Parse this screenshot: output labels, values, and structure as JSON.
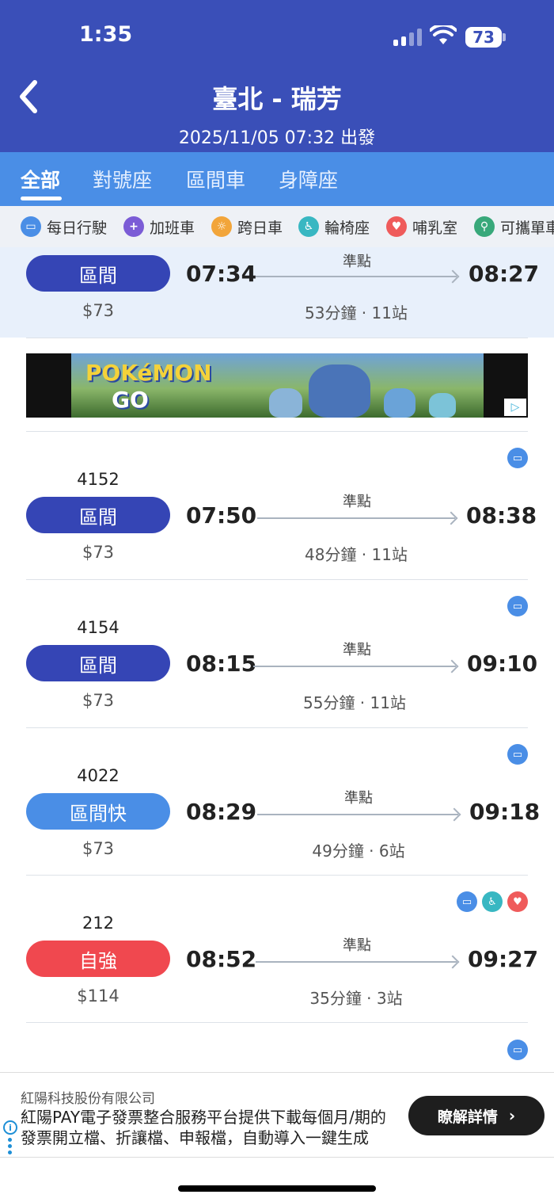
{
  "status_bar": {
    "time": "1:35",
    "battery": "73"
  },
  "header": {
    "title": "臺北 - 瑞芳",
    "subtitle": "2025/11/05 07:32 出發"
  },
  "tabs": [
    {
      "label": "全部",
      "active": true
    },
    {
      "label": "對號座",
      "active": false
    },
    {
      "label": "區間車",
      "active": false
    },
    {
      "label": "身障座",
      "active": false
    }
  ],
  "filters": [
    {
      "label": "每日行駛",
      "icon": "train-icon",
      "color": "#4a8ee6"
    },
    {
      "label": "加班車",
      "icon": "extra-train-icon",
      "color": "#7b5cd6"
    },
    {
      "label": "跨日車",
      "icon": "overnight-icon",
      "color": "#f2a53a"
    },
    {
      "label": "輪椅座",
      "icon": "wheelchair-icon",
      "color": "#38b7c2"
    },
    {
      "label": "哺乳室",
      "icon": "nursing-room-icon",
      "color": "#ef5b5b"
    },
    {
      "label": "可攜單車",
      "icon": "bicycle-icon",
      "color": "#38a87a"
    }
  ],
  "trains": [
    {
      "number": "",
      "type": "區間",
      "type_color": "#3545b5",
      "depart": "07:34",
      "arrive": "08:27",
      "status": "準點",
      "price": "$73",
      "duration": "53分鐘 · 11站"
    },
    {
      "number": "4152",
      "type": "區間",
      "type_color": "#3545b5",
      "depart": "07:50",
      "arrive": "08:38",
      "status": "準點",
      "price": "$73",
      "duration": "48分鐘 · 11站"
    },
    {
      "number": "4154",
      "type": "區間",
      "type_color": "#3545b5",
      "depart": "08:15",
      "arrive": "09:10",
      "status": "準點",
      "price": "$73",
      "duration": "55分鐘 · 11站"
    },
    {
      "number": "4022",
      "type": "區間快",
      "type_color": "#4a8ee6",
      "depart": "08:29",
      "arrive": "09:18",
      "status": "準點",
      "price": "$73",
      "duration": "49分鐘 · 6站"
    },
    {
      "number": "212",
      "type": "自強",
      "type_color": "#f0484f",
      "depart": "08:52",
      "arrive": "09:27",
      "status": "準點",
      "price": "$114",
      "duration": "35分鐘 · 3站"
    }
  ],
  "ad_banner": {
    "logo": "POKéMON",
    "logo_sub": "GO"
  },
  "bottom_ad": {
    "company": "紅陽科技股份有限公司",
    "line1": "紅陽PAY電子發票整合服務平台提供下載每個月/期的",
    "line2": "發票開立檔、折讓檔、申報檔，自動導入一鍵生成",
    "button": "瞭解詳情"
  }
}
